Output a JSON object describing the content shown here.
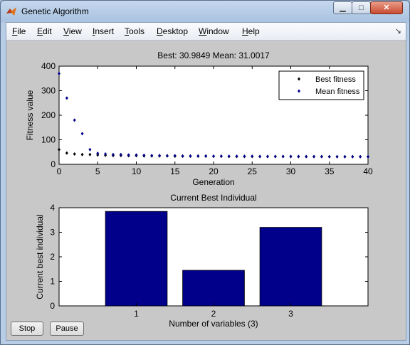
{
  "window": {
    "title": "Genetic Algorithm"
  },
  "titlebar": {
    "minimize_glyph": "▁",
    "maximize_glyph": "□",
    "close_glyph": "✕"
  },
  "menu": {
    "items": [
      {
        "label": "File",
        "key": "F",
        "rest": "ile"
      },
      {
        "label": "Edit",
        "key": "E",
        "rest": "dit"
      },
      {
        "label": "View",
        "key": "V",
        "rest": "iew"
      },
      {
        "label": "Insert",
        "key": "I",
        "rest": "nsert"
      },
      {
        "label": "Tools",
        "key": "T",
        "rest": "ools"
      },
      {
        "label": "Desktop",
        "key": "D",
        "rest": "esktop"
      },
      {
        "label": "Window",
        "key": "W",
        "rest": "indow"
      },
      {
        "label": "Help",
        "key": "H",
        "rest": "elp"
      }
    ],
    "dock_glyph": "↘"
  },
  "buttons": {
    "stop": "Stop",
    "pause": "Pause"
  },
  "chart_data": [
    {
      "type": "scatter",
      "title": "Best: 30.9849 Mean: 31.0017",
      "xlabel": "Generation",
      "ylabel": "Fitness value",
      "xlim": [
        0,
        40
      ],
      "ylim": [
        0,
        400
      ],
      "xticks": [
        0,
        5,
        10,
        15,
        20,
        25,
        30,
        35,
        40
      ],
      "yticks": [
        0,
        100,
        200,
        300,
        400
      ],
      "legend": {
        "placement": "top-right"
      },
      "series": [
        {
          "name": "Best fitness",
          "color": "#000000",
          "x": [
            0,
            1,
            2,
            3,
            4,
            5,
            6,
            7,
            8,
            9,
            10,
            11,
            12,
            13,
            14,
            15,
            16,
            17,
            18,
            19,
            20,
            21,
            22,
            23,
            24,
            25,
            26,
            27,
            28,
            29,
            30,
            31,
            32,
            33,
            34,
            35,
            36,
            37,
            38,
            39,
            40
          ],
          "y": [
            60,
            46,
            42,
            40,
            40,
            38,
            37,
            36,
            36,
            35,
            35,
            34,
            34,
            34,
            34,
            33,
            33,
            33,
            33,
            33,
            33,
            33,
            32,
            32,
            32,
            32,
            32,
            32,
            32,
            32,
            32,
            31.5,
            31.5,
            31.5,
            31.5,
            31.2,
            31.2,
            31.1,
            31,
            31,
            30.98
          ]
        },
        {
          "name": "Mean fitness",
          "color": "#00008b",
          "x": [
            0,
            1,
            2,
            3,
            4,
            5,
            6,
            7,
            8,
            9,
            10,
            11,
            12,
            13,
            14,
            15,
            16,
            17,
            18,
            19,
            20,
            21,
            22,
            23,
            24,
            25,
            26,
            27,
            28,
            29,
            30,
            31,
            32,
            33,
            34,
            35,
            36,
            37,
            38,
            39,
            40
          ],
          "y": [
            370,
            270,
            180,
            125,
            60,
            45,
            42,
            40,
            40,
            38,
            38,
            37,
            36,
            36,
            35,
            35,
            34,
            34,
            34,
            34,
            33,
            33,
            33,
            33,
            33,
            33,
            32,
            32,
            32,
            32,
            32,
            32,
            31.5,
            31.5,
            31.5,
            31.3,
            31.2,
            31.1,
            31.05,
            31.02,
            31.0017
          ]
        }
      ]
    },
    {
      "type": "bar",
      "title": "Current Best Individual",
      "xlabel": "Number of variables (3)",
      "ylabel": "Current best individual",
      "categories": [
        "1",
        "2",
        "3"
      ],
      "values": [
        3.85,
        1.45,
        3.2
      ],
      "ylim": [
        0,
        4
      ],
      "yticks": [
        0,
        1,
        2,
        3,
        4
      ],
      "color": "#00008b"
    }
  ]
}
